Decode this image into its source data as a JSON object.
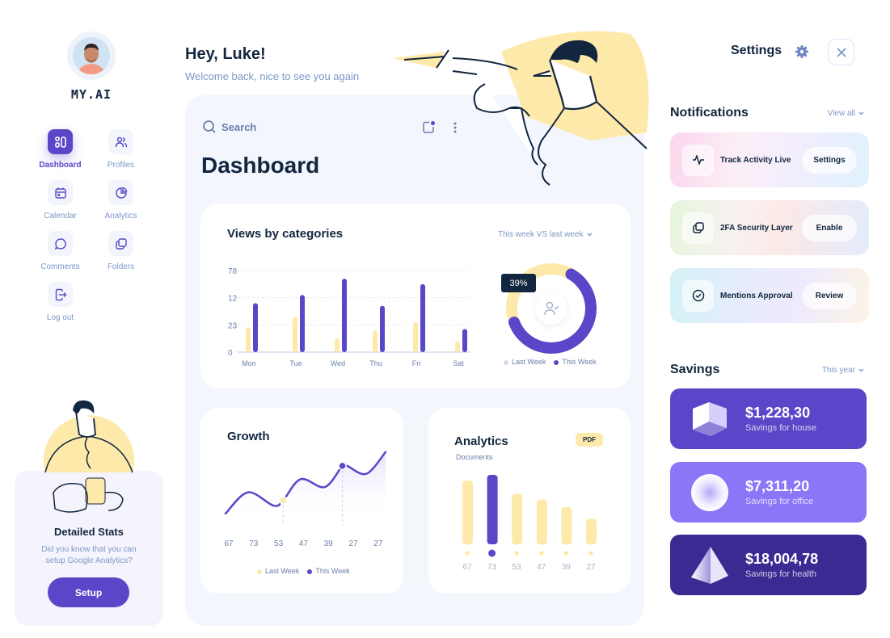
{
  "brand": "MY.AI",
  "sidebar": {
    "items": [
      {
        "label": "Dashboard",
        "icon": "dashboard-icon",
        "active": true
      },
      {
        "label": "Profiles",
        "icon": "users-icon",
        "active": false
      },
      {
        "label": "Calendar",
        "icon": "calendar-icon",
        "active": false
      },
      {
        "label": "Analytics",
        "icon": "pie-chart-icon",
        "active": false
      },
      {
        "label": "Comments",
        "icon": "chat-icon",
        "active": false
      },
      {
        "label": "Folders",
        "icon": "folders-icon",
        "active": false
      },
      {
        "label": "Log out",
        "icon": "logout-icon",
        "active": false
      }
    ],
    "promo": {
      "title": "Detailed Stats",
      "description": "Did you know that you can setup Google Analytics?",
      "button": "Setup"
    }
  },
  "header": {
    "greeting": "Hey, Luke!",
    "welcome": "Welcome back, nice to see you again"
  },
  "main": {
    "search_placeholder": "Search",
    "title": "Dashboard"
  },
  "colors": {
    "accent": "#5a46c8",
    "last_week": "#fde9a9",
    "text_dark": "#12263f",
    "muted": "#7d98c7"
  },
  "chart_data": [
    {
      "type": "bar",
      "title": "Views by categories",
      "filter": "This week VS last week",
      "categories": [
        "Mon",
        "Tue",
        "Wed",
        "Thu",
        "Fri",
        "Sat"
      ],
      "y_tick_labels": [
        "0",
        "23",
        "12",
        "78"
      ],
      "ylim": [
        0,
        3
      ],
      "grid": true,
      "series": [
        {
          "name": "Last Week",
          "color": "#fde9a9",
          "values": [
            0.9,
            1.3,
            0.5,
            0.8,
            1.1,
            0.4
          ]
        },
        {
          "name": "This Week",
          "color": "#5a46c8",
          "values": [
            1.8,
            2.1,
            2.7,
            1.7,
            2.5,
            0.85
          ]
        }
      ]
    },
    {
      "type": "pie",
      "title": "This week VS last week",
      "slices": [
        {
          "name": "Last Week",
          "value": 39,
          "color": "#fde9a9"
        },
        {
          "name": "This Week",
          "value": 61,
          "color": "#5a46c8"
        }
      ],
      "tooltip": "39%",
      "legend": [
        "Last Week",
        "This Week"
      ]
    },
    {
      "type": "line",
      "title": "Growth",
      "x_tick_labels": [
        "67",
        "73",
        "53",
        "47",
        "39",
        "27",
        "27"
      ],
      "ylim": [
        0,
        100
      ],
      "series": [
        {
          "name": "This Week",
          "color": "#5a46c8",
          "points": [
            [
              0,
              5
            ],
            [
              0.14,
              37
            ],
            [
              0.3,
              17
            ],
            [
              0.36,
              25
            ],
            [
              0.47,
              57
            ],
            [
              0.62,
              45
            ],
            [
              0.73,
              77
            ],
            [
              0.76,
              77
            ],
            [
              0.88,
              65
            ],
            [
              1.0,
              98
            ]
          ]
        }
      ],
      "markers": [
        {
          "series": "Last Week",
          "x": 0.36,
          "y": 25,
          "color": "#fde9a9"
        },
        {
          "series": "This Week",
          "x": 0.73,
          "y": 77,
          "color": "#5a46c8"
        }
      ],
      "legend": [
        "Last Week",
        "This Week"
      ]
    },
    {
      "type": "bar",
      "title": "Analytics",
      "subtitle": "Documents",
      "badge": "PDF",
      "categories": [
        "67",
        "73",
        "53",
        "47",
        "39",
        "27"
      ],
      "values": [
        67,
        73,
        53,
        47,
        39,
        27
      ],
      "highlight_index": 1,
      "ylim": [
        0,
        80
      ]
    }
  ],
  "right": {
    "settings_title": "Settings",
    "notifications": {
      "title": "Notifications",
      "link": "View all",
      "items": [
        {
          "label": "Track Activity Live",
          "button": "Settings",
          "icon": "activity-icon"
        },
        {
          "label": "2FA Security Layer",
          "button": "Enable",
          "icon": "copy-icon"
        },
        {
          "label": "Mentions Approval",
          "button": "Review",
          "icon": "check-circle-icon"
        }
      ]
    },
    "savings": {
      "title": "Savings",
      "filter": "This year",
      "items": [
        {
          "amount": "$1,228,30",
          "label": "Savings for house",
          "shape": "cube"
        },
        {
          "amount": "$7,311,20",
          "label": "Savings for office",
          "shape": "sphere"
        },
        {
          "amount": "$18,004,78",
          "label": "Savings for health",
          "shape": "pyramid"
        }
      ]
    }
  }
}
